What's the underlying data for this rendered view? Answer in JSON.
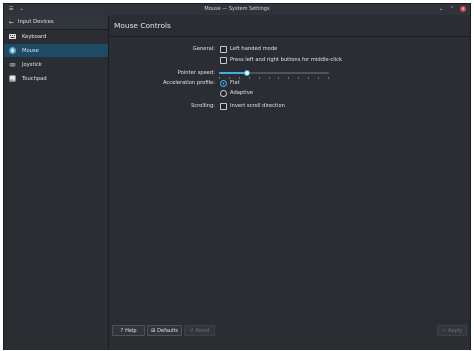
{
  "window": {
    "title": "Mouse — System Settings",
    "menu_glyphs": [
      "☰",
      "⌄"
    ],
    "buttons": {
      "minimize": "⌄",
      "maximize": "⌃",
      "close": "×"
    }
  },
  "sidebar": {
    "header": {
      "back_icon": "←",
      "label": "Input Devices"
    },
    "items": [
      {
        "label": "Keyboard",
        "icon": "keyboard-icon",
        "color": "#e8e8e8",
        "active": false
      },
      {
        "label": "Mouse",
        "icon": "mouse-icon",
        "color": "#5ba7c8",
        "active": true
      },
      {
        "label": "Joystick",
        "icon": "joystick-icon",
        "color": "#8a8f94",
        "active": false
      },
      {
        "label": "Touchpad",
        "icon": "touchpad-icon",
        "color": "#e8e8e8",
        "active": false
      }
    ]
  },
  "main": {
    "title": "Mouse Controls",
    "general": {
      "label": "General:",
      "left_handed": {
        "label": "Left handed mode",
        "checked": false
      },
      "middle_click": {
        "label": "Press left and right buttons for middle-click",
        "checked": false
      }
    },
    "pointer_speed": {
      "label": "Pointer speed:",
      "value_fraction": 0.25
    },
    "acceleration": {
      "label": "Acceleration profile:",
      "options": [
        {
          "label": "Flat",
          "selected": true
        },
        {
          "label": "Adaptive",
          "selected": false
        }
      ]
    },
    "scrolling": {
      "label": "Scrolling:",
      "invert": {
        "label": "Invert scroll direction",
        "checked": false
      }
    }
  },
  "footer": {
    "help": {
      "icon": "?",
      "label": "Help"
    },
    "defaults": {
      "icon": "⊞",
      "label": "Defaults"
    },
    "reset": {
      "icon": "↺",
      "label": "Reset"
    },
    "apply": {
      "icon": "✓",
      "label": "Apply"
    }
  },
  "colors": {
    "accent": "#3daee9",
    "selected_bg": "#1d4a66"
  }
}
